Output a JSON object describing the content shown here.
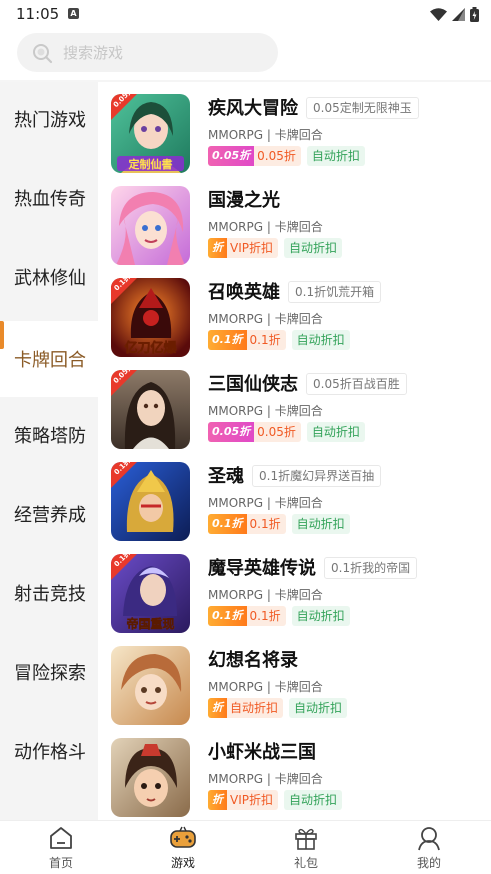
{
  "status_bar": {
    "time": "11:05",
    "notification_icon": "A"
  },
  "search": {
    "placeholder": "搜索游戏"
  },
  "sidebar": {
    "items": [
      {
        "label": "热门游戏"
      },
      {
        "label": "热血传奇"
      },
      {
        "label": "武林修仙"
      },
      {
        "label": "卡牌回合"
      },
      {
        "label": "策略塔防"
      },
      {
        "label": "经营养成"
      },
      {
        "label": "射击竞技"
      },
      {
        "label": "冒险探索"
      },
      {
        "label": "动作格斗"
      }
    ],
    "active_index": 3
  },
  "games": [
    {
      "name": "疾风大冒险",
      "promo": "0.05定制无限神玉",
      "category": "MMORPG | 卡牌回合",
      "badge": "0.05折",
      "discount": "0.05折",
      "auto": "自动折扣",
      "thumb_text": "定制仙書",
      "corner": "0.05折"
    },
    {
      "name": "国漫之光",
      "promo": "",
      "category": "MMORPG | 卡牌回合",
      "badge": "折",
      "discount": "VIP折扣",
      "auto": "自动折扣",
      "thumb_text": "",
      "corner": ""
    },
    {
      "name": "召唤英雄",
      "promo": "0.1折饥荒开箱",
      "category": "MMORPG | 卡牌回合",
      "badge": "0.1折",
      "discount": "0.1折",
      "auto": "自动折扣",
      "thumb_text": "亿刀亿爆",
      "corner": "0.1折"
    },
    {
      "name": "三国仙侠志",
      "promo": "0.05折百战百胜",
      "category": "MMORPG | 卡牌回合",
      "badge": "0.05折",
      "discount": "0.05折",
      "auto": "自动折扣",
      "thumb_text": "",
      "corner": "0.05折"
    },
    {
      "name": "圣魂",
      "promo": "0.1折魔幻异界送百抽",
      "category": "MMORPG | 卡牌回合",
      "badge": "0.1折",
      "discount": "0.1折",
      "auto": "自动折扣",
      "thumb_text": "",
      "corner": "0.1折"
    },
    {
      "name": "魔导英雄传说",
      "promo": "0.1折我的帝国",
      "category": "MMORPG | 卡牌回合",
      "badge": "0.1折",
      "discount": "0.1折",
      "auto": "自动折扣",
      "thumb_text": "帝国重现",
      "corner": "0.1折"
    },
    {
      "name": "幻想名将录",
      "promo": "",
      "category": "MMORPG | 卡牌回合",
      "badge": "折",
      "discount": "自动折扣",
      "auto": "自动折扣",
      "thumb_text": "",
      "corner": ""
    },
    {
      "name": "小虾米战三国",
      "promo": "",
      "category": "MMORPG | 卡牌回合",
      "badge": "折",
      "discount": "VIP折扣",
      "auto": "自动折扣",
      "thumb_text": "",
      "corner": ""
    }
  ],
  "bottom_nav": {
    "items": [
      {
        "label": "首页",
        "icon": "home-icon"
      },
      {
        "label": "游戏",
        "icon": "gamepad-icon"
      },
      {
        "label": "礼包",
        "icon": "gift-icon"
      },
      {
        "label": "我的",
        "icon": "profile-icon"
      }
    ],
    "active_index": 1
  },
  "colors": {
    "accent": "#e98a2a",
    "active_text": "#8a5a25",
    "discount_text": "#f05a24",
    "auto_green": "#34a35a"
  }
}
